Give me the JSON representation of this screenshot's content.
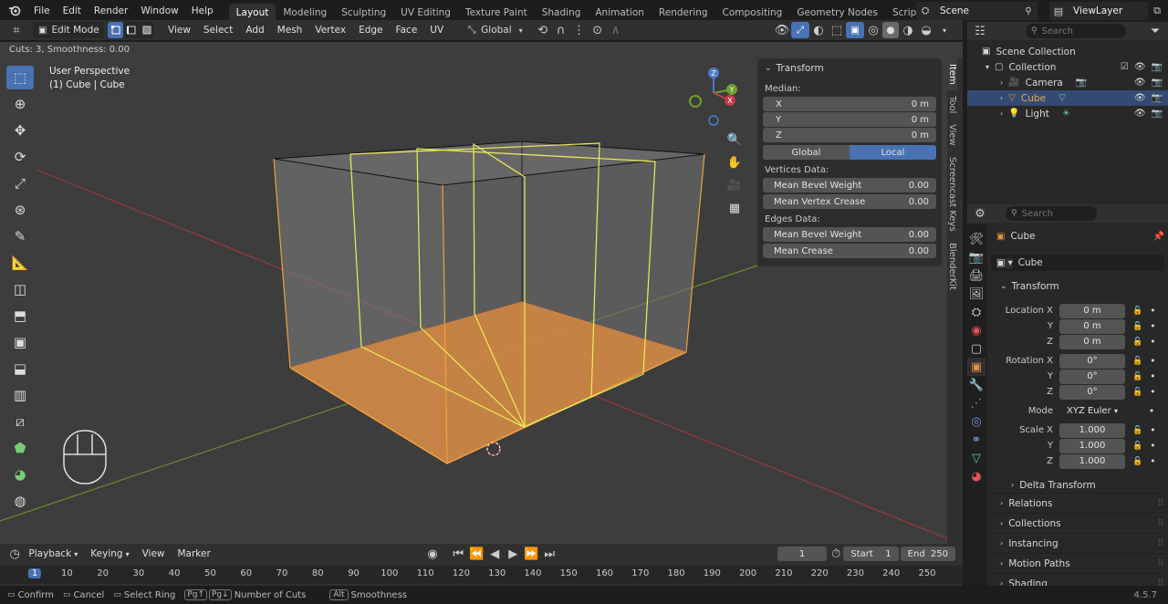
{
  "menu": [
    "File",
    "Edit",
    "Render",
    "Window",
    "Help"
  ],
  "workspaces": [
    "Layout",
    "Modeling",
    "Sculpting",
    "UV Editing",
    "Texture Paint",
    "Shading",
    "Animation",
    "Rendering",
    "Compositing",
    "Geometry Nodes",
    "Scripting"
  ],
  "add_ws": "+",
  "scene": "Scene",
  "viewlayer": "ViewLayer",
  "vp_header": {
    "mode": "Edit Mode",
    "items": [
      "View",
      "Select",
      "Add",
      "Mesh",
      "Vertex",
      "Edge",
      "Face",
      "UV"
    ],
    "orientation": "Global"
  },
  "op_hint": "Cuts: 3, Smoothness: 0.00",
  "overlay": {
    "perspective": "User Perspective",
    "object": "(1) Cube | Cube"
  },
  "gizmo": {
    "z": "Z",
    "y": "Y",
    "x": "X"
  },
  "npanel": {
    "title": "Transform",
    "median": "Median:",
    "xyz": [
      {
        "k": "X",
        "v": "0 m"
      },
      {
        "k": "Y",
        "v": "0 m"
      },
      {
        "k": "Z",
        "v": "0 m"
      }
    ],
    "global": "Global",
    "local": "Local",
    "vdata": "Vertices Data:",
    "vrows": [
      {
        "k": "Mean Bevel Weight",
        "v": "0.00"
      },
      {
        "k": "Mean Vertex Crease",
        "v": "0.00"
      }
    ],
    "edata": "Edges Data:",
    "erows": [
      {
        "k": "Mean Bevel Weight",
        "v": "0.00"
      },
      {
        "k": "Mean Crease",
        "v": "0.00"
      }
    ]
  },
  "side_tabs": [
    "Item",
    "Tool",
    "View",
    "Screencast Keys",
    "BlenderKit"
  ],
  "outliner": {
    "search": "Search",
    "root": "Scene Collection",
    "collection": "Collection",
    "items": [
      "Camera",
      "Cube",
      "Light"
    ]
  },
  "props": {
    "search": "Search",
    "object": "Cube",
    "name": "Cube",
    "transform": "Transform",
    "location": [
      {
        "k": "Location X",
        "v": "0 m"
      },
      {
        "k": "Y",
        "v": "0 m"
      },
      {
        "k": "Z",
        "v": "0 m"
      }
    ],
    "rotation": [
      {
        "k": "Rotation X",
        "v": "0°"
      },
      {
        "k": "Y",
        "v": "0°"
      },
      {
        "k": "Z",
        "v": "0°"
      }
    ],
    "mode_label": "Mode",
    "mode_value": "XYZ Euler",
    "scale": [
      {
        "k": "Scale X",
        "v": "1.000"
      },
      {
        "k": "Y",
        "v": "1.000"
      },
      {
        "k": "Z",
        "v": "1.000"
      }
    ],
    "delta": "Delta Transform",
    "sections": [
      "Relations",
      "Collections",
      "Instancing",
      "Motion Paths",
      "Shading"
    ]
  },
  "timeline": {
    "menus": [
      "Playback",
      "Keying",
      "View",
      "Marker"
    ],
    "frame": "1",
    "start_label": "Start",
    "start": "1",
    "end_label": "End",
    "end": "250",
    "ticks": [
      "1",
      "10",
      "20",
      "30",
      "40",
      "50",
      "60",
      "70",
      "80",
      "90",
      "100",
      "110",
      "120",
      "130",
      "140",
      "150",
      "160",
      "170",
      "180",
      "190",
      "200",
      "210",
      "220",
      "230",
      "240",
      "250"
    ]
  },
  "status": {
    "confirm": "Confirm",
    "cancel": "Cancel",
    "select_ring": "Select Ring",
    "pgup": "Pg↑",
    "pgdn": "Pg↓",
    "cuts": "Number of Cuts",
    "alt": "Alt",
    "smooth": "Smoothness",
    "version": "4.5.7"
  }
}
